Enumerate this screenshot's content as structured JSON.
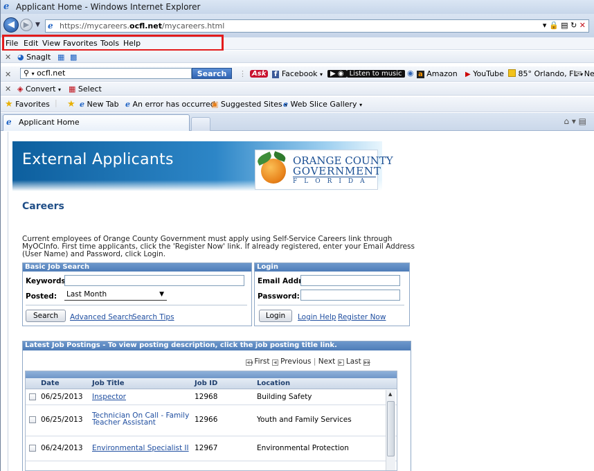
{
  "window": {
    "title": "Applicant Home - Windows Internet Explorer"
  },
  "address": {
    "url_prefix": "https://mycareers.",
    "url_domain": "ocfl.net",
    "url_path": "/mycareers.html"
  },
  "menu": [
    "File",
    "Edit",
    "View",
    "Favorites",
    "Tools",
    "Help"
  ],
  "snagit": {
    "label": "SnagIt"
  },
  "searchbar": {
    "query": "ocfl.net",
    "search_label": "Search",
    "ask_label": "Ask",
    "facebook_label": "Facebook",
    "music_label": "Listen to music",
    "amazon_label": "Amazon",
    "youtube_label": "YouTube",
    "weather_label": "85° Orlando, FL",
    "more_label": "Ne"
  },
  "convert": {
    "convert_label": "Convert",
    "select_label": "Select"
  },
  "favorites": {
    "label": "Favorites",
    "items": [
      "New Tab",
      "An error has occurred",
      "Suggested Sites",
      "Web Slice Gallery"
    ]
  },
  "tabs": {
    "active": "Applicant Home"
  },
  "banner": {
    "title": "External Applicants",
    "logo_line1": "ORANGE COUNTY",
    "logo_line2": "GOVERNMENT",
    "logo_line3": "FLORIDA"
  },
  "page": {
    "heading": "Careers",
    "intro": "Current employees of Orange County Government must apply using Self-Service Careers link through MyOCInfo. First time applicants, click the 'Register Now' link.  If already registered, enter your Email Address (User Name) and Password, click Login."
  },
  "job_search": {
    "header": "Basic Job Search",
    "keywords_label": "Keywords:",
    "keywords_value": "",
    "posted_label": "Posted:",
    "posted_value": "Last Month",
    "search_button": "Search",
    "advanced_link": "Advanced Search",
    "tips_link": "Search Tips"
  },
  "login": {
    "header": "Login",
    "email_label": "Email Addr:",
    "password_label": "Password:",
    "login_button": "Login",
    "help_link": "Login Help",
    "register_link": "Register Now"
  },
  "postings": {
    "header": "Latest Job Postings - To view posting description, click the job posting title link.",
    "pager": {
      "first": "First",
      "previous": "Previous",
      "next": "Next",
      "last": "Last"
    },
    "columns": [
      "Date",
      "Job Title",
      "Job ID",
      "Location"
    ],
    "rows": [
      {
        "date": "06/25/2013",
        "title": "Inspector",
        "title2": "",
        "id": "12968",
        "location": "Building Safety"
      },
      {
        "date": "06/25/2013",
        "title": "Technician On Call - Family",
        "title2": "Teacher Assistant",
        "id": "12966",
        "location": "Youth and Family Services"
      },
      {
        "date": "06/24/2013",
        "title": "Environmental Specialist II",
        "title2": "",
        "id": "12967",
        "location": "Environmental Protection"
      }
    ]
  }
}
